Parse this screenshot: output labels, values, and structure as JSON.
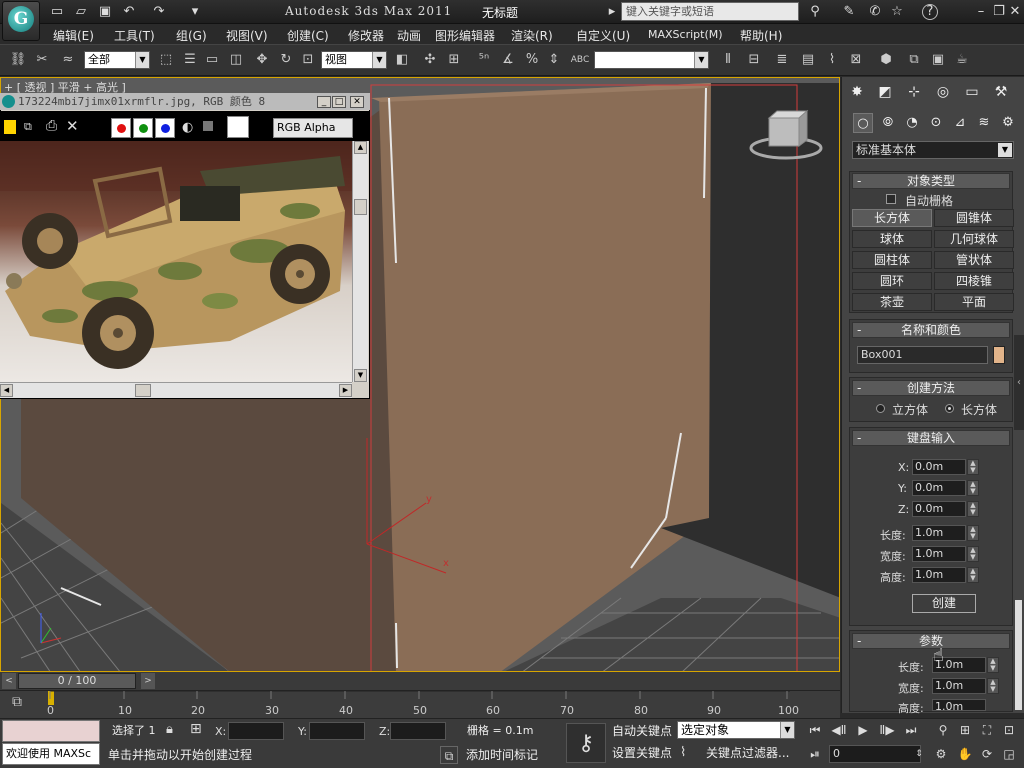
{
  "titlebar": {
    "app_title": "Autodesk 3ds Max  2011",
    "doc_title": "无标题",
    "search_placeholder": "键入关键字或短语",
    "help_label": "?"
  },
  "menu": [
    "编辑(E)",
    "工具(T)",
    "组(G)",
    "视图(V)",
    "创建(C)",
    "修改器",
    "动画",
    "图形编辑器",
    "渲染(R)",
    "自定义(U)",
    "MAXScript(M)",
    "帮助(H)"
  ],
  "toolbar": {
    "selection_filter": "全部",
    "ref_coord": "视图",
    "named_selection": ""
  },
  "viewport": {
    "label": "+ [ 透视 ] 平滑 + 高光 ]",
    "axis_x": "x",
    "axis_y": "y"
  },
  "image_viewer": {
    "title": "173224mbi7jimx01xrmflr.jpg, RGB 颜色 8",
    "channel": "RGB Alpha"
  },
  "command_panel": {
    "category": "标准基本体",
    "object_type": {
      "header": "对象类型",
      "autogrid": "自动栅格",
      "buttons": [
        "长方体",
        "圆锥体",
        "球体",
        "几何球体",
        "圆柱体",
        "管状体",
        "圆环",
        "四棱锥",
        "茶壶",
        "平面"
      ],
      "active": "长方体"
    },
    "name_color": {
      "header": "名称和颜色",
      "name": "Box001",
      "color": "#e2b48a"
    },
    "creation_method": {
      "header": "创建方法",
      "options": [
        "立方体",
        "长方体"
      ],
      "selected": "长方体"
    },
    "keyboard_entry": {
      "header": "键盘输入",
      "fields": [
        {
          "label": "X:",
          "value": "0.0m"
        },
        {
          "label": "Y:",
          "value": "0.0m"
        },
        {
          "label": "Z:",
          "value": "0.0m"
        },
        {
          "label": "长度:",
          "value": "1.0m"
        },
        {
          "label": "宽度:",
          "value": "1.0m"
        },
        {
          "label": "高度:",
          "value": "1.0m"
        }
      ],
      "create_button": "创建"
    },
    "parameters": {
      "header": "参数",
      "fields": [
        {
          "label": "长度:",
          "value": "1.0m"
        },
        {
          "label": "宽度:",
          "value": "1.0m"
        },
        {
          "label": "高度:",
          "value": "1.0m"
        }
      ]
    }
  },
  "timeline": {
    "slider": "0 / 100",
    "ticks": [
      "0",
      "10",
      "20",
      "30",
      "40",
      "50",
      "60",
      "70",
      "80",
      "90",
      "100"
    ]
  },
  "statusbar": {
    "maxscript": "欢迎使用  MAXSc",
    "selected": "选择了 1",
    "x_label": "X:",
    "y_label": "Y:",
    "z_label": "Z:",
    "x_value": "",
    "y_value": "",
    "z_value": "",
    "grid": "栅格 = 0.1m",
    "prompt": "单击并拖动以开始创建过程",
    "add_time_tag": "添加时间标记",
    "auto_key": "自动关键点",
    "set_key": "设置关键点",
    "selected_obj": "选定对象",
    "key_filters": "关键点过滤器...",
    "frame": "0"
  }
}
